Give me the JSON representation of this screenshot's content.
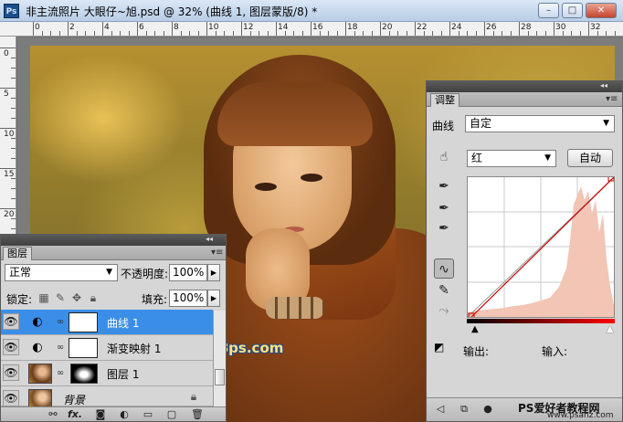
{
  "window": {
    "app_badge": "Ps",
    "title": "非主流照片 大眼仔~旭.psd @ 32% (曲线 1, 图层蒙版/8) *",
    "minimize_glyph": "–",
    "maximize_glyph": "□",
    "close_glyph": "✕"
  },
  "rulers": {
    "top": [
      "0",
      "2",
      "4",
      "6",
      "8",
      "10",
      "12",
      "14",
      "16",
      "18",
      "20",
      "22",
      "24",
      "26",
      "28",
      "30",
      "32"
    ],
    "left": [
      "0",
      "5",
      "10",
      "15",
      "20"
    ]
  },
  "canvas": {
    "watermark": "www.68ps.com"
  },
  "layers_panel": {
    "collapse_glyph": "◂◂",
    "tab": "图层",
    "blend_mode": "正常",
    "opacity_label": "不透明度:",
    "opacity_value": "100%",
    "lock_label": "锁定:",
    "fill_label": "填充:",
    "fill_value": "100%",
    "layers": [
      {
        "name": "曲线 1",
        "type": "adjustment",
        "selected": true
      },
      {
        "name": "渐变映射 1",
        "type": "adjustment",
        "selected": false
      },
      {
        "name": "图层 1",
        "type": "pixel",
        "selected": false
      },
      {
        "name": "背景",
        "type": "background",
        "selected": false
      }
    ],
    "bottom_icons": [
      "link-icon",
      "fx-icon",
      "mask-icon",
      "adjustment-icon",
      "folder-icon",
      "new-layer-icon",
      "trash-icon"
    ]
  },
  "adjustments_panel": {
    "collapse_glyph": "◂◂",
    "tab": "调整",
    "type_label": "曲线",
    "preset_value": "自定",
    "channel_value": "红",
    "auto_button": "自动",
    "output_label": "输出:",
    "input_label": "输入:",
    "curve_color": "#cc0000",
    "histogram_color": "#f2c5b4",
    "watermark_text": "PS爱好者教程网",
    "watermark_url": "www.psahz.com"
  }
}
